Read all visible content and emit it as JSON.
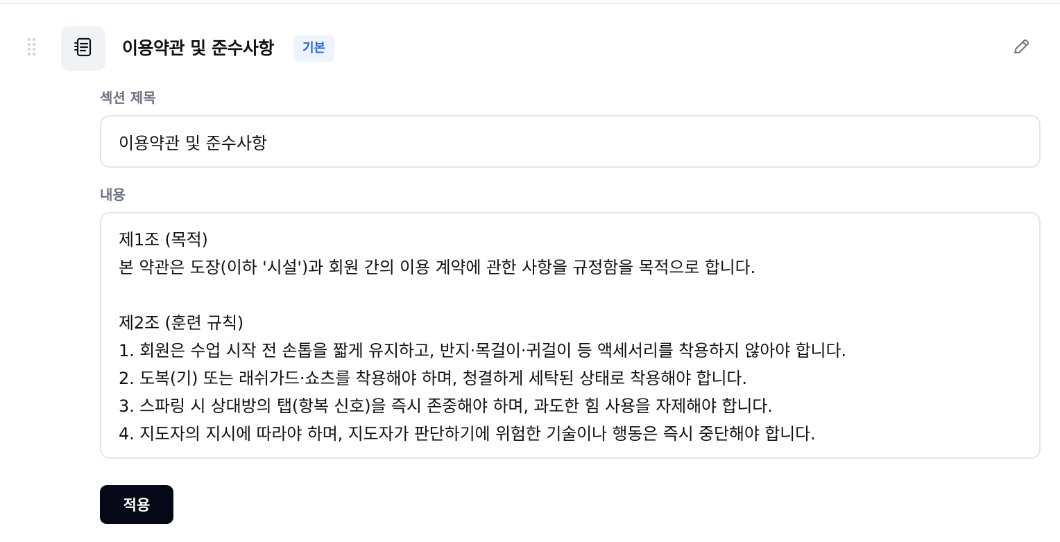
{
  "section": {
    "title": "이용약관 및 준수사항",
    "badge": "기본"
  },
  "form": {
    "title_label": "섹션 제목",
    "title_value": "이용약관 및 준수사항",
    "content_label": "내용",
    "content_lines": [
      "제1조 (목적)",
      "본 약관은 도장(이하 '시설')과 회원 간의 이용 계약에 관한 사항을 규정함을 목적으로 합니다.",
      "",
      "제2조 (훈련 규칙)",
      "1. 회원은 수업 시작 전 손톱을 짧게 유지하고, 반지·목걸이·귀걸이 등 액세서리를 착용하지 않아야 합니다.",
      "2. 도복(기) 또는 래쉬가드·쇼츠를 착용해야 하며, 청결하게 세탁된 상태로 착용해야 합니다.",
      "3. 스파링 시 상대방의 탭(항복 신호)을 즉시 존중해야 하며, 과도한 힘 사용을 자제해야 합니다.",
      "4. 지도자의 지시에 따라야 하며, 지도자가 판단하기에 위험한 기술이나 행동은 즉시 중단해야 합니다."
    ],
    "apply_label": "적용"
  },
  "icons": {
    "drag": "drag-handle-icon",
    "section": "document-list-icon",
    "edit": "pencil-icon"
  },
  "colors": {
    "badge_text": "#2563eb",
    "badge_background": "#edf3ff",
    "button_background": "#050816"
  }
}
